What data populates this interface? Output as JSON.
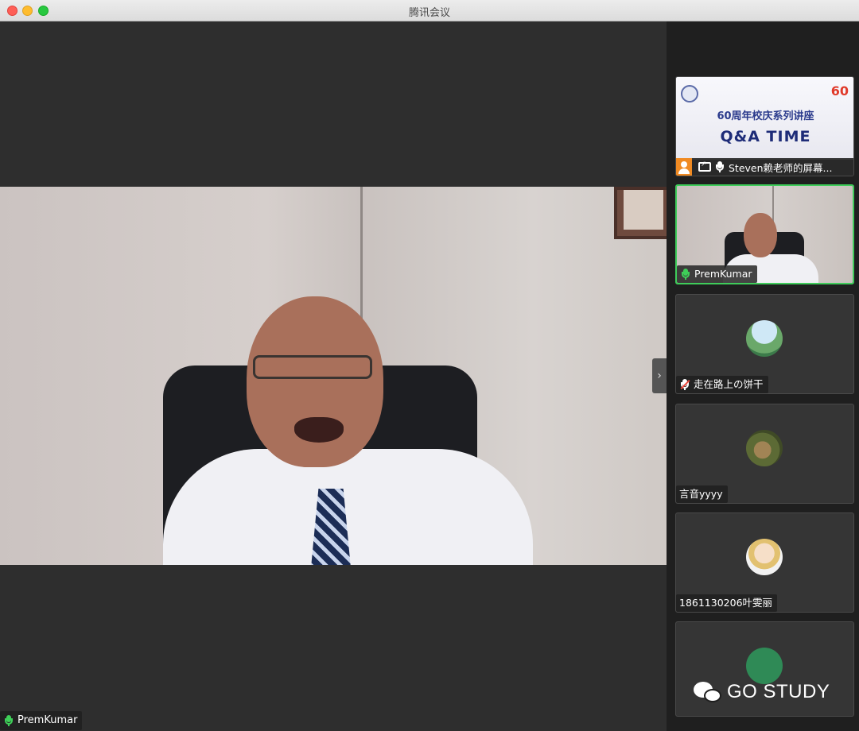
{
  "window": {
    "title": "腾讯会议"
  },
  "main_speaker": {
    "name": "PremKumar"
  },
  "sidebar": {
    "share_tile": {
      "slide_line1": "60周年校庆系列讲座",
      "slide_line2": "Q&A TIME",
      "slide_logo_text": "60",
      "label": "Steven赖老师的屏幕..."
    },
    "participants": [
      {
        "name": "PremKumar",
        "mic": "active",
        "active_speaker": true
      },
      {
        "name": "走在路上の饼干",
        "mic": "muted"
      },
      {
        "name": "言音yyyy",
        "mic": "none"
      },
      {
        "name": "1861130206叶雯丽",
        "mic": "none"
      },
      {
        "name": "",
        "mic": "none"
      }
    ]
  },
  "watermark": {
    "text": "GO STUDY"
  },
  "colors": {
    "active_border": "#3fcc5a",
    "mic_active": "#3ecf58",
    "mic_muted_slash": "#f04a3d",
    "host_icon": "#f08a22"
  }
}
